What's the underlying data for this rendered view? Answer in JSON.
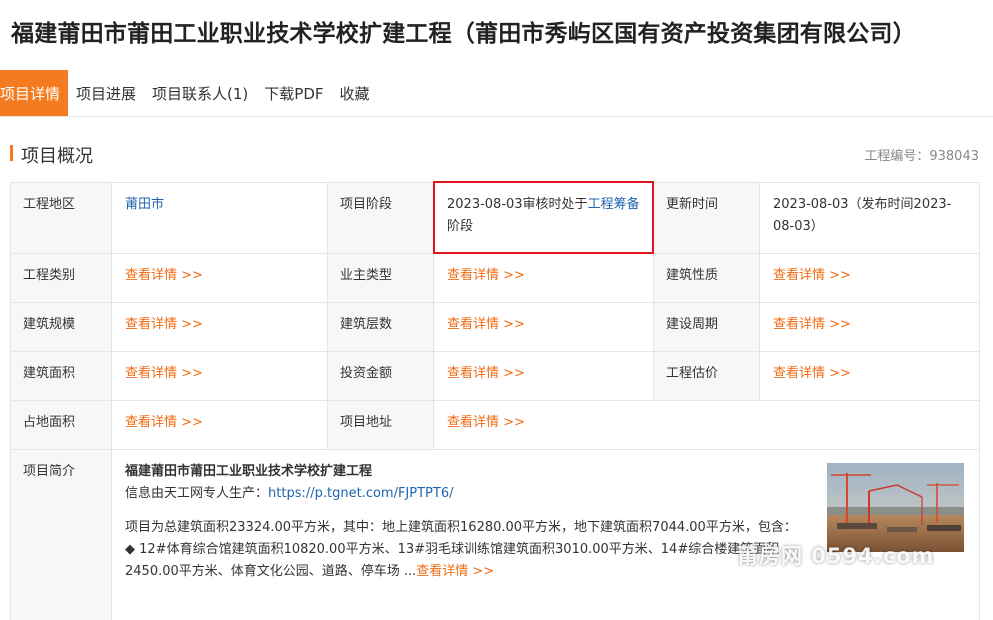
{
  "page_title": "福建莆田市莆田工业职业技术学校扩建工程（莆田市秀屿区国有资产投资集团有限公司）",
  "tabs": [
    {
      "label": "项目详情",
      "active": true
    },
    {
      "label": "项目进展"
    },
    {
      "label": "项目联系人(1)"
    },
    {
      "label": "下载PDF"
    },
    {
      "label": "收藏"
    }
  ],
  "section": {
    "title": "项目概况",
    "project_no": "工程编号：938043"
  },
  "details": {
    "region_label": "工程地区",
    "region_value": "莆田市",
    "stage_label": "项目阶段",
    "stage_value_prefix": "2023-08-03审核时处于",
    "stage_value_link": "工程筹备",
    "stage_value_suffix": "阶段",
    "update_label": "更新时间",
    "update_value": "2023-08-03（发布时间2023-08-03）",
    "category_label": "工程类别",
    "owner_type_label": "业主类型",
    "nature_label": "建筑性质",
    "scale_label": "建筑规模",
    "floors_label": "建筑层数",
    "period_label": "建设周期",
    "area_label": "建筑面积",
    "investment_label": "投资金额",
    "estimate_label": "工程估价",
    "land_label": "占地面积",
    "address_label": "项目地址",
    "view_more": "查看详情 >>"
  },
  "intro": {
    "label": "项目简介",
    "title": "福建莆田市莆田工业职业技术学校扩建工程",
    "source_prefix": "信息由天工网专人生产：",
    "source_link": "https://p.tgnet.com/FJPTPT6/",
    "para1": "项目为总建筑面积23324.00平方米，其中：地上建筑面积16280.00平方米，地下建筑面积7044.00平方米，包含：",
    "para2": "◆ 12#体育综合馆建筑面积10820.00平方米、13#羽毛球训练馆建筑面积3010.00平方米、14#综合楼建筑面积2450.00平方米、体育文化公园、道路、停车场 ...",
    "more": "查看详情 >>"
  },
  "watermark": "莆房网 0594.com",
  "colors": {
    "accent": "#f57b21",
    "link": "#1f64b0",
    "highlight": "#e0141e"
  }
}
